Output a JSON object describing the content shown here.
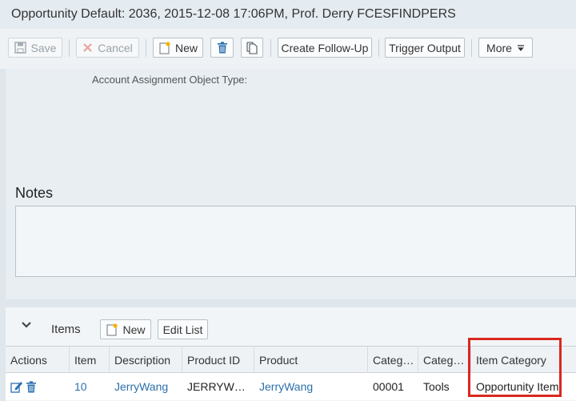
{
  "window": {
    "title": "Opportunity Default: 2036, 2015-12-08 17:06PM, Prof. Derry FCESFINDPERS"
  },
  "toolbar": {
    "save_label": "Save",
    "cancel_label": "Cancel",
    "new_label": "New",
    "create_followup_label": "Create Follow-Up",
    "trigger_output_label": "Trigger Output",
    "more_label": "More"
  },
  "details": {
    "account_assignment_label": "Account Assignment Object Type:"
  },
  "notes": {
    "title": "Notes",
    "value": ""
  },
  "items": {
    "title": "Items",
    "new_label": "New",
    "edit_list_label": "Edit List",
    "columns": [
      "Actions",
      "Item",
      "Description",
      "Product ID",
      "Product",
      "Categ…",
      "Categ…",
      "Item Category"
    ],
    "rows": [
      {
        "item": "10",
        "description": "JerryWang",
        "product_id": "JERRYW…",
        "product": "JerryWang",
        "category1": "00001",
        "category2": "Tools",
        "item_category": "Opportunity Item"
      }
    ]
  },
  "colors": {
    "link": "#2b6fab",
    "highlight": "#d9281f",
    "delete_icon": "#2a6fb0"
  }
}
